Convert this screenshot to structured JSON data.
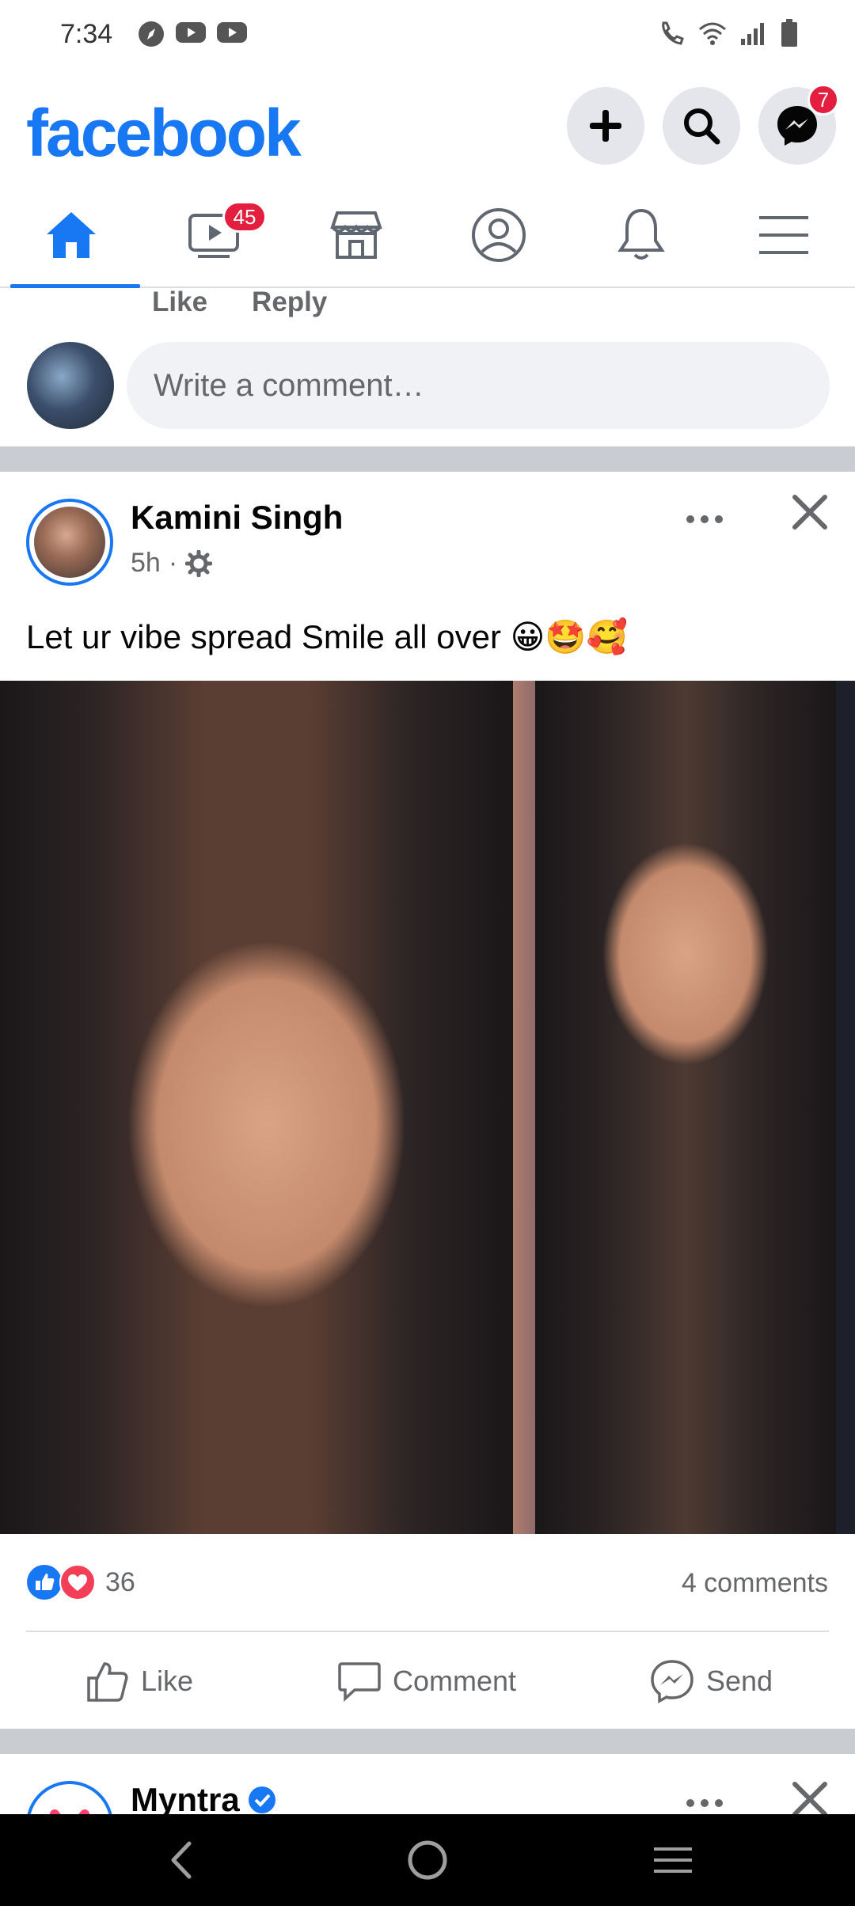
{
  "status_bar": {
    "time": "7:34",
    "left_icons": [
      "compass-icon",
      "youtube-icon",
      "youtube-icon"
    ],
    "right_icons": [
      "wifi-call-icon",
      "wifi-icon",
      "signal-icon",
      "battery-icon"
    ]
  },
  "header": {
    "logo": "facebook",
    "messenger_badge": "7",
    "brand_color": "#1877f2"
  },
  "tabs": [
    {
      "name": "home",
      "icon": "home-icon",
      "active": true
    },
    {
      "name": "watch",
      "icon": "video-icon",
      "badge": "45"
    },
    {
      "name": "marketplace",
      "icon": "store-icon"
    },
    {
      "name": "profile",
      "icon": "profile-icon"
    },
    {
      "name": "notifications",
      "icon": "bell-icon"
    },
    {
      "name": "menu",
      "icon": "menu-icon"
    }
  ],
  "previous_comment": {
    "like_label": "Like",
    "reply_label": "Reply"
  },
  "comment_box": {
    "placeholder": "Write a comment…"
  },
  "post": {
    "author": "Kamini Singh",
    "time": "5h",
    "text": "Let ur vibe spread Smile all over 😀🤩🥰",
    "reaction_count": "36",
    "comments_label": "4 comments",
    "actions": {
      "like": "Like",
      "comment": "Comment",
      "send": "Send"
    }
  },
  "next_post": {
    "author": "Myntra",
    "verified": true
  },
  "colors": {
    "accent": "#1877f2",
    "badge": "#e41e3f",
    "separator": "#c9ccd1",
    "secondary_text": "#65676b"
  }
}
